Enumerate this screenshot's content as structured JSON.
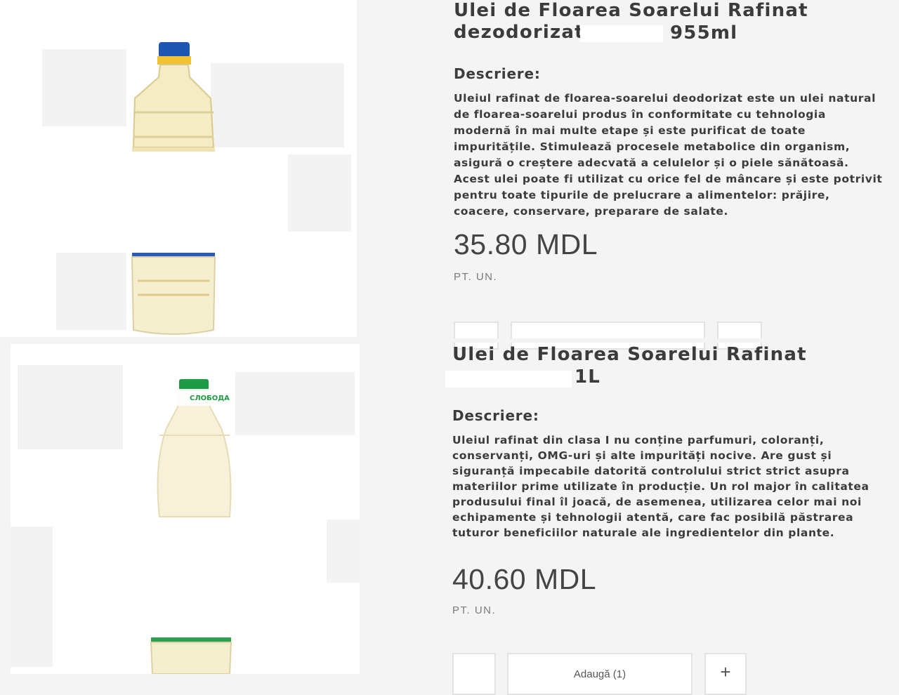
{
  "products": [
    {
      "title_line1": "Ulei de Floarea Soarelui Rafinat",
      "title_line2": "dezodorizat",
      "title_suffix": "955ml",
      "description_label": "Descriere:",
      "description": "Uleiul rafinat de floarea-soarelui deodorizat este un ulei natural de floarea-soarelui produs în conformitate cu tehnologia modernă în mai multe etape și este purificat de toate impuritățile. Stimulează procesele metabolice din organism, asigură o creștere adecvată a celulelor și o piele sănătoasă. Acest ulei poate fi utilizat cu orice fel de mâncare și este potrivit pentru toate tipurile de prelucrare a alimentelor: prăjire, coacere, conservare, preparare de salate.",
      "price": "35.80 MDL",
      "unit": "PT. UN.",
      "cap_color": "#1e56b3"
    },
    {
      "title_line1": "Ulei de Floarea Soarelui Rafinat",
      "title_suffix": "1L",
      "description_label": "Descriere:",
      "description": "Uleiul rafinat din clasa I nu conține parfumuri, coloranți, conservanți, OMG-uri și alte impurități nocive. Are gust și siguranță impecabile datorită controlului strict strict asupra materiilor prime utilizate în producție. Un rol major în calitatea produsului final îl joacă, de asemenea, utilizarea celor mai noi echipamente și tehnologii atentă, care fac posibilă păstrarea tuturor beneficiilor naturale ale ingredientelor din plante.",
      "price": "40.60 MDL",
      "unit": "PT. UN.",
      "label_text": "СЛОБОДА",
      "add_button_label": "Adaugă (1)",
      "plus_label": "+",
      "cap_color": "#1f9a45"
    }
  ]
}
